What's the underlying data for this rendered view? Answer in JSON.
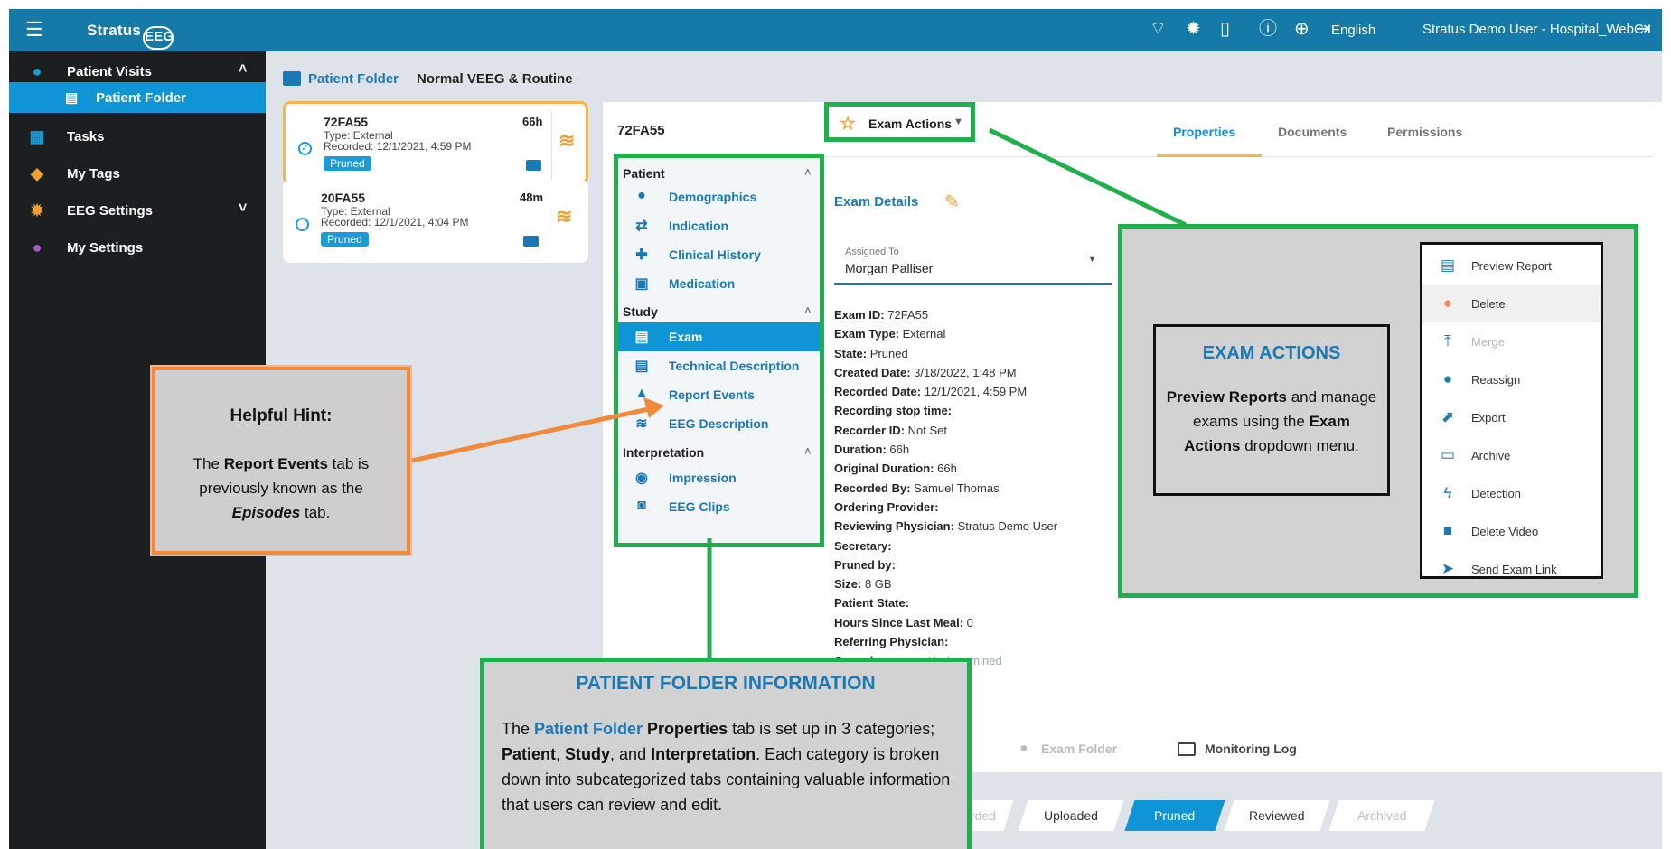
{
  "topbar": {
    "app_name": "Stratus",
    "app_name_suffix": "EEG",
    "language": "English",
    "user": "Stratus Demo User - Hospital_WebC"
  },
  "sidebar": {
    "items": [
      {
        "label": "Patient Visits",
        "icon": "person-icon"
      },
      {
        "label": "Patient Folder",
        "icon": "folder-icon"
      },
      {
        "label": "Tasks",
        "icon": "calendar-icon"
      },
      {
        "label": "My Tags",
        "icon": "tag-icon"
      },
      {
        "label": "EEG Settings",
        "icon": "gear-icon"
      },
      {
        "label": "My Settings",
        "icon": "user-circle-icon"
      }
    ]
  },
  "breadcrumb": {
    "folder": "Patient Folder",
    "study": "Normal VEEG & Routine"
  },
  "cards": [
    {
      "id": "72FA55",
      "duration": "66h",
      "type": "Type: External",
      "recorded": "Recorded: 12/1/2021, 4:59 PM",
      "status": "Pruned"
    },
    {
      "id": "20FA55",
      "duration": "48m",
      "type": "Type: External",
      "recorded": "Recorded: 12/1/2021, 4:04 PM",
      "status": "Pruned"
    }
  ],
  "panel": {
    "patient_id": "72FA55",
    "exam_actions": "Exam Actions",
    "tabs": [
      "Properties",
      "Documents",
      "Permissions"
    ]
  },
  "categories": {
    "patient": "Patient",
    "patient_items": [
      "Demographics",
      "Indication",
      "Clinical History",
      "Medication"
    ],
    "study": "Study",
    "study_items": [
      "Exam",
      "Technical Description",
      "Report Events",
      "EEG Description"
    ],
    "interpretation": "Interpretation",
    "interpretation_items": [
      "Impression",
      "EEG Clips"
    ]
  },
  "exam_details": {
    "title": "Exam Details",
    "assigned_label": "Assigned To",
    "assigned_value": "Morgan Palliser",
    "fields": [
      {
        "k": "Exam ID:",
        "v": "72FA55"
      },
      {
        "k": "Exam Type:",
        "v": "External"
      },
      {
        "k": "State:",
        "v": "Pruned"
      },
      {
        "k": "Created Date:",
        "v": "3/18/2022, 1:48 PM"
      },
      {
        "k": "Recorded Date:",
        "v": "12/1/2021, 4:59 PM"
      },
      {
        "k": "Recording stop time:",
        "v": ""
      },
      {
        "k": "Recorder ID:",
        "v": "Not Set"
      },
      {
        "k": "Duration:",
        "v": "66h"
      },
      {
        "k": "Original Duration:",
        "v": "66h"
      },
      {
        "k": "Recorded By:",
        "v": "Samuel Thomas"
      },
      {
        "k": "Ordering Provider:",
        "v": ""
      },
      {
        "k": "Reviewing Physician:",
        "v": "Stratus Demo User"
      },
      {
        "k": "Secretary:",
        "v": ""
      },
      {
        "k": "Pruned by:",
        "v": ""
      },
      {
        "k": "Size:",
        "v": "8 GB"
      },
      {
        "k": "Patient State:",
        "v": ""
      },
      {
        "k": "Hours Since Last Meal:",
        "v": "0"
      },
      {
        "k": "Referring Physician:",
        "v": ""
      },
      {
        "k": "Consciousness:",
        "v": "Undetermined"
      }
    ]
  },
  "bottom_links": {
    "exam_folder": "Exam Folder",
    "monitoring_log": "Monitoring Log"
  },
  "stages": [
    "rded",
    "Uploaded",
    "Pruned",
    "Reviewed",
    "Archived"
  ],
  "exam_menu": [
    {
      "label": "Preview Report",
      "icon": "report-icon"
    },
    {
      "label": "Delete",
      "icon": "delete-icon"
    },
    {
      "label": "Merge",
      "icon": "merge-icon"
    },
    {
      "label": "Reassign",
      "icon": "reassign-icon"
    },
    {
      "label": "Export",
      "icon": "export-icon"
    },
    {
      "label": "Archive",
      "icon": "archive-icon"
    },
    {
      "label": "Detection",
      "icon": "lightning-icon"
    },
    {
      "label": "Delete Video",
      "icon": "video-delete-icon"
    },
    {
      "label": "Send Exam Link",
      "icon": "send-icon"
    }
  ],
  "callouts": {
    "hint_title": "Helpful Hint:",
    "hint_p1": "The ",
    "hint_b1": "Report Events",
    "hint_p2": " tab is previously known as the ",
    "hint_b2": "Episodes",
    "hint_p3": " tab.",
    "exam_title": "EXAM ACTIONS",
    "exam_b1": "Preview Reports",
    "exam_p1": " and manage exams using the ",
    "exam_b2": "Exam Actions",
    "exam_p2": " dropdown menu.",
    "pfi_title": "PATIENT FOLDER INFORMATION",
    "pfi_p1": "The ",
    "pfi_blue": "Patient Folder",
    "pfi_b1": " Properties",
    "pfi_p2": " tab is set up in 3 categories; ",
    "pfi_b2": "Patient",
    "pfi_p3": ", ",
    "pfi_b3": "Study",
    "pfi_p4": ", and ",
    "pfi_b4": "Interpretation",
    "pfi_p5": ". Each category is broken down into subcategorized tabs containing valuable information that users can review and edit."
  },
  "colors": {
    "topbar": "#157aa8",
    "accent": "#0f95d6",
    "callout_border": "#1fb04b",
    "hint_border": "#f08a3a"
  }
}
